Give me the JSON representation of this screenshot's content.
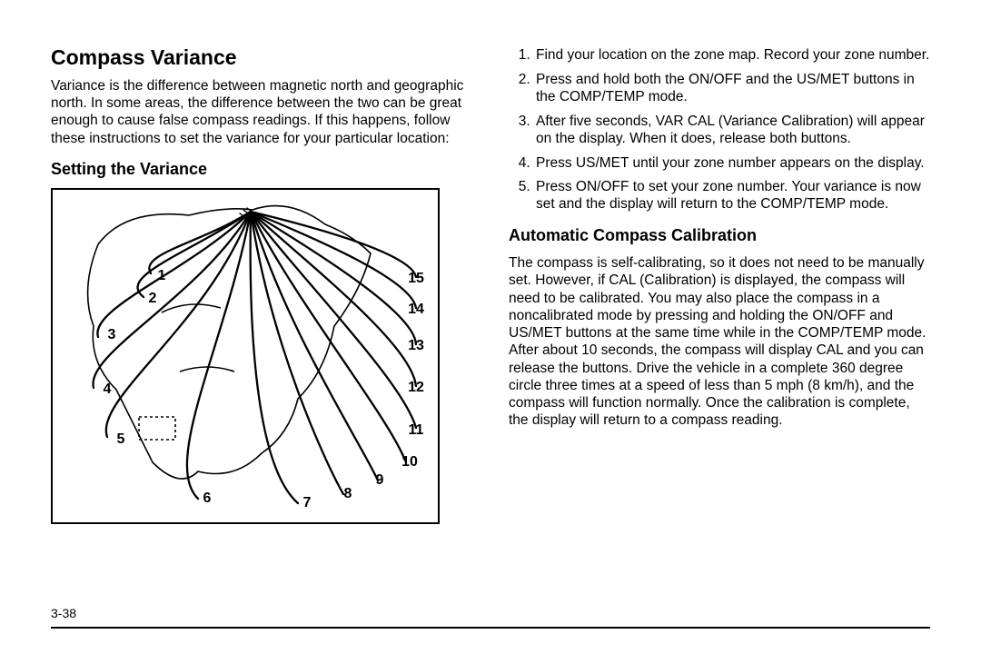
{
  "page_number": "3-38",
  "left": {
    "h1": "Compass Variance",
    "intro": "Variance is the difference between magnetic north and geographic north. In some areas, the difference between the two can be great enough to cause false compass readings. If this happens, follow these instructions to set the variance for your particular location:",
    "h2": "Setting the Variance",
    "zones": [
      "1",
      "2",
      "3",
      "4",
      "5",
      "6",
      "7",
      "8",
      "9",
      "10",
      "11",
      "12",
      "13",
      "14",
      "15"
    ]
  },
  "right": {
    "steps": [
      "Find your location on the zone map. Record your zone number.",
      "Press and hold both the ON/OFF and the US/MET buttons in the COMP/TEMP mode.",
      "After five seconds, VAR CAL (Variance Calibration) will appear on the display. When it does, release both buttons.",
      "Press US/MET until your zone number appears on the display.",
      "Press ON/OFF to set your zone number. Your variance is now set and the display will return to the COMP/TEMP mode."
    ],
    "h2": "Automatic Compass Calibration",
    "para": "The compass is self-calibrating, so it does not need to be manually set. However, if CAL (Calibration) is displayed, the compass will need to be calibrated. You may also place the compass in a noncalibrated mode by pressing and holding the ON/OFF and US/MET buttons at the same time while in the COMP/TEMP mode. After about 10 seconds, the compass will display CAL and you can release the buttons. Drive the vehicle in a complete 360 degree circle three times at a speed of less than 5 mph (8 km/h), and the compass will function normally. Once the calibration is complete, the display will return to a compass reading."
  }
}
